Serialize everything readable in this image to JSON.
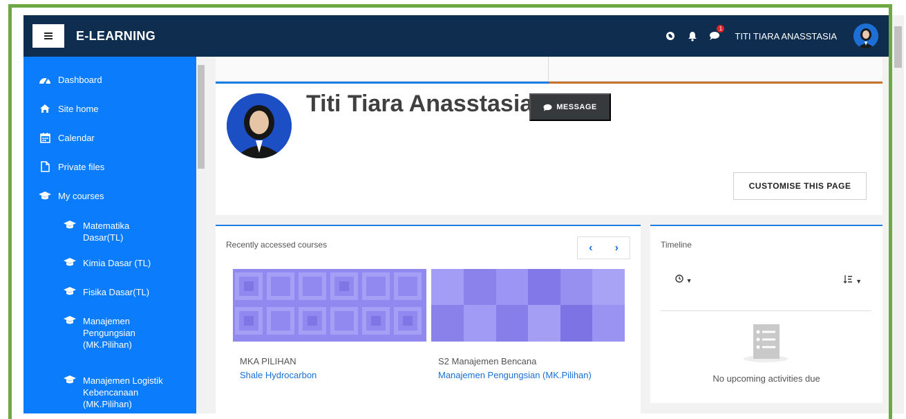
{
  "navbar": {
    "brand": "E-LEARNING",
    "notification_count": "1",
    "user_name": "TITI TIARA ANASSTASIA"
  },
  "sidebar": {
    "items": [
      {
        "label": "Dashboard",
        "icon": "dashboard-icon"
      },
      {
        "label": "Site home",
        "icon": "home-icon"
      },
      {
        "label": "Calendar",
        "icon": "calendar-icon"
      },
      {
        "label": "Private files",
        "icon": "file-icon"
      },
      {
        "label": "My courses",
        "icon": "graduation-cap-icon"
      }
    ],
    "courses": [
      {
        "label": "Matematika Dasar(TL)"
      },
      {
        "label": "Kimia Dasar (TL)"
      },
      {
        "label": "Fisika Dasar(TL)"
      },
      {
        "label": "Manajemen Pengungsian (MK.Pilihan)"
      },
      {
        "label": "Manajemen Logistik Kebencanaan (MK.Pilihan)"
      }
    ]
  },
  "profile": {
    "name": "Titi Tiara Anasstasia",
    "message_label": "MESSAGE",
    "customise_label": "CUSTOMISE THIS PAGE"
  },
  "recent": {
    "title": "Recently accessed courses",
    "courses": [
      {
        "category": "MKA PILIHAN",
        "name": "Shale Hydrocarbon"
      },
      {
        "category": "S2 Manajemen Bencana",
        "name": "Manajemen Pengungsian (MK.Pilihan)"
      }
    ]
  },
  "timeline": {
    "title": "Timeline",
    "empty_text": "No upcoming activities due"
  },
  "colors": {
    "navbar": "#0f2e4f",
    "sidebar": "#0a7cfc",
    "accent": "#1a7de4",
    "frame": "#6ea843"
  }
}
